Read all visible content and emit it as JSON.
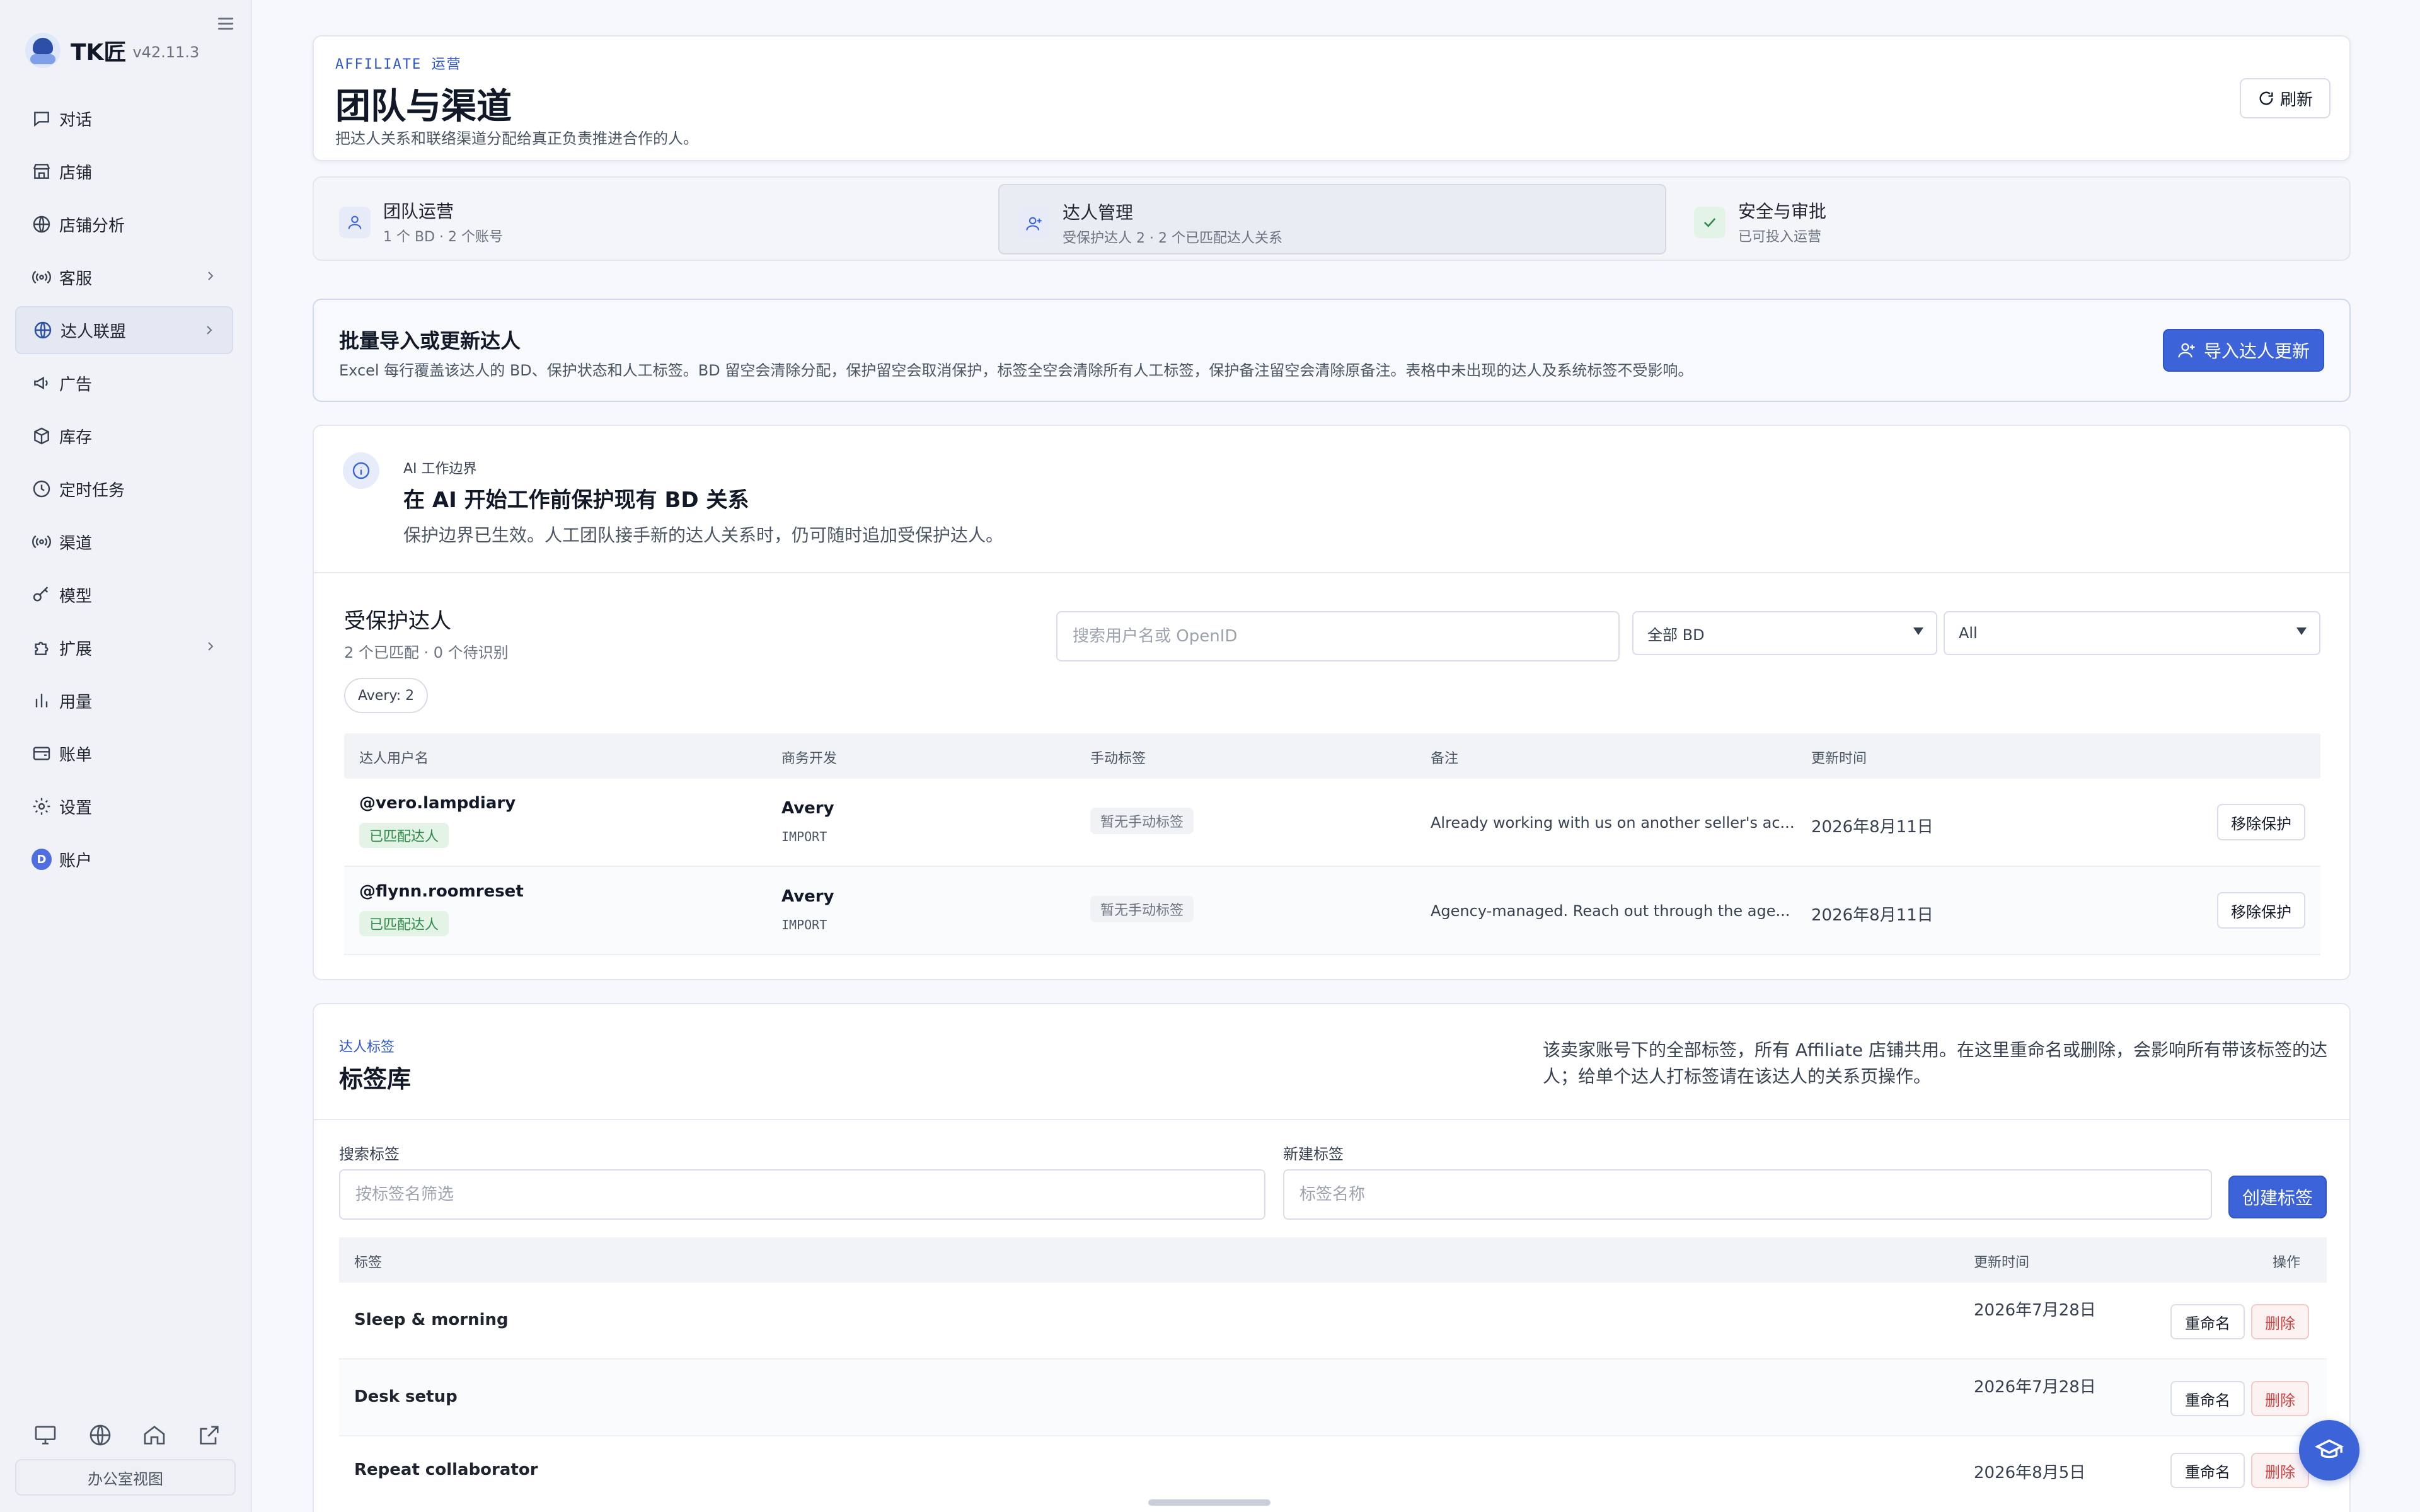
{
  "brand": {
    "name": "TK匠",
    "version": "v42.11.3"
  },
  "sidebar": {
    "items": [
      {
        "label": "对话",
        "icon": "chat-icon",
        "active": false,
        "chevron": false
      },
      {
        "label": "店铺",
        "icon": "store-icon",
        "active": false,
        "chevron": false
      },
      {
        "label": "店铺分析",
        "icon": "globe-icon",
        "active": false,
        "chevron": false
      },
      {
        "label": "客服",
        "icon": "broadcast-icon",
        "active": false,
        "chevron": true
      },
      {
        "label": "达人联盟",
        "icon": "globe-icon",
        "active": true,
        "chevron": true
      },
      {
        "label": "广告",
        "icon": "megaphone-icon",
        "active": false,
        "chevron": false
      },
      {
        "label": "库存",
        "icon": "box-icon",
        "active": false,
        "chevron": false
      },
      {
        "label": "定时任务",
        "icon": "clock-icon",
        "active": false,
        "chevron": false
      },
      {
        "label": "渠道",
        "icon": "broadcast-icon",
        "active": false,
        "chevron": false
      },
      {
        "label": "模型",
        "icon": "key-icon",
        "active": false,
        "chevron": false
      },
      {
        "label": "扩展",
        "icon": "puzzle-icon",
        "active": false,
        "chevron": true
      },
      {
        "label": "用量",
        "icon": "bar-chart-icon",
        "active": false,
        "chevron": false
      },
      {
        "label": "账单",
        "icon": "wallet-icon",
        "active": false,
        "chevron": false
      },
      {
        "label": "设置",
        "icon": "gear-icon",
        "active": false,
        "chevron": false
      },
      {
        "label": "账户",
        "icon": "avatar-icon",
        "avatar_letter": "D",
        "active": false,
        "chevron": false
      }
    ],
    "bottom_icons": [
      "monitor-icon",
      "globe-icon",
      "home-icon",
      "external-link-icon"
    ],
    "office_view": "办公室视图"
  },
  "header": {
    "eyebrow": "AFFILIATE 运营",
    "title": "团队与渠道",
    "subtitle": "把达人关系和联络渠道分配给真正负责推进合作的人。",
    "refresh": "刷新"
  },
  "tabs": [
    {
      "title": "团队运营",
      "sub": "1 个 BD · 2 个账号",
      "icon": "user-icon"
    },
    {
      "title": "达人管理",
      "sub": "受保护达人 2 · 2 个已匹配达人关系",
      "icon": "user-plus-icon"
    },
    {
      "title": "安全与审批",
      "sub": "已可投入运营",
      "icon": "check-icon"
    }
  ],
  "import_panel": {
    "title": "批量导入或更新达人",
    "desc": "Excel 每行覆盖该达人的 BD、保护状态和人工标签。BD 留空会清除分配，保护留空会取消保护，标签全空会清除所有人工标签，保护备注留空会清除原备注。表格中未出现的达人及系统标签不受影响。",
    "button": "导入达人更新"
  },
  "ai_boundary": {
    "eyebrow": "AI 工作边界",
    "title": "在 AI 开始工作前保护现有 BD 关系",
    "desc": "保护边界已生效。人工团队接手新的达人关系时，仍可随时追加受保护达人。"
  },
  "protected": {
    "title": "受保护达人",
    "sub": "2 个已匹配 · 0 个待识别",
    "search_placeholder": "搜索用户名或 OpenID",
    "bd_filter": "全部 BD",
    "status_filter": "All",
    "chip": "Avery: 2",
    "columns": [
      "达人用户名",
      "商务开发",
      "手动标签",
      "备注",
      "更新时间"
    ],
    "rows": [
      {
        "user": "@vero.lampdiary",
        "status": "已匹配达人",
        "bd": "Avery",
        "source": "IMPORT",
        "tags": "暂无手动标签",
        "note": "Already working with us on another seller's ac...",
        "time": "2026年8月11日",
        "action": "移除保护"
      },
      {
        "user": "@flynn.roomreset",
        "status": "已匹配达人",
        "bd": "Avery",
        "source": "IMPORT",
        "tags": "暂无手动标签",
        "note": "Agency-managed. Reach out through the age...",
        "time": "2026年8月11日",
        "action": "移除保护"
      }
    ]
  },
  "tag_library": {
    "eyebrow": "达人标签",
    "title": "标签库",
    "desc": "该卖家账号下的全部标签，所有 Affiliate 店铺共用。在这里重命名或删除，会影响所有带该标签的达人；给单个达人打标签请在该达人的关系页操作。",
    "search_label": "搜索标签",
    "search_placeholder": "按标签名筛选",
    "new_label": "新建标签",
    "new_placeholder": "标签名称",
    "create": "创建标签",
    "columns": {
      "tag": "标签",
      "time": "更新时间",
      "ops": "操作"
    },
    "rows": [
      {
        "name": "Sleep & morning",
        "time": "2026年7月28日",
        "rename": "重命名",
        "delete": "删除"
      },
      {
        "name": "Desk setup",
        "time": "2026年7月28日",
        "rename": "重命名",
        "delete": "删除"
      },
      {
        "name": "Repeat collaborator",
        "time": "2026年8月5日",
        "rename": "重命名",
        "delete": "删除"
      }
    ]
  },
  "colors": {
    "accent": "#3c64d8",
    "success": "#2f8a4a",
    "danger": "#d14343"
  }
}
